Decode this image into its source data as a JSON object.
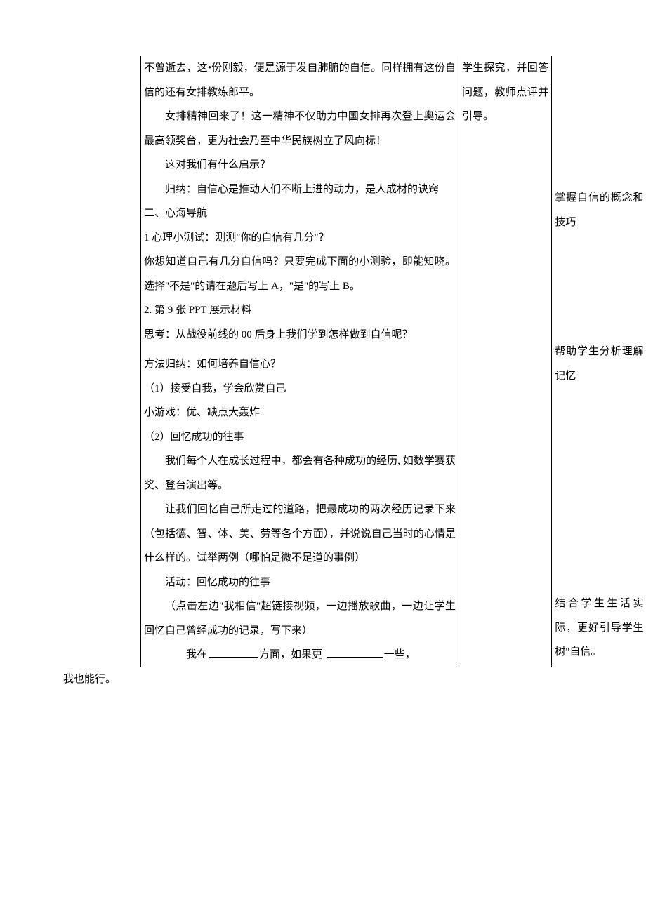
{
  "col1": {
    "p1": "不曾逝去，这•份刚毅，便是源于发自肺腑的自信。同样拥有这份自信的还有女排教练郎平。",
    "p2": "女排精神回来了！这一精神不仅助力中国女排再次登上奥运会最高领奖台，更为社会乃至中华民族树立了风向标！",
    "p3": "这对我们有什么启示？",
    "p4": "归纳：自信心是推动人们不断上进的动力，是人成材的诀窍",
    "h1": "二、心海导航",
    "p5": "1 心理小测试：测测\"你的自信有几分\"？",
    "p6": "你想知道自己有几分自信吗？只要完成下面的小测验，即能知晓。选择\"不是\"的请在题后写上 A，\"是\"的写上 B。",
    "p7": "2. 第 9 张 PPT 展示材料",
    "p8": "思考：从战役前线的 00 后身上我们学到怎样做到自信呢？",
    "method_title": "方法归纳：如何培养自信心？",
    "m1": "（1）接受自我，学会欣赏自己",
    "m1b": "小游戏：优、缺点大轰炸",
    "m2": "（2）回忆成功的往事",
    "p9": "我们每个人在成长过程中，都会有各种成功的经历, 如数学赛获奖、登台演出等。",
    "p10": "让我们回忆自己所走过的道路，把最成功的两次经历记录下来（包括德、智、体、美、劳等各个方面），并说说自己当时的心情是什么样的。试举两例（哪怕是微不足道的事例）",
    "p11": "活动：回忆成功的往事",
    "p12": "（点击左边\"我相信\"超链接视频，一边播放歌曲，一边让学生回忆自己曾经成功的记录，写下来）",
    "fill_prefix": "我在",
    "fill_mid": "方面，如果更",
    "fill_suffix": "一些，"
  },
  "col2": {
    "p1": "学生探究，并回答问题，教师点评并引导。"
  },
  "col3": {
    "p1": "掌握自信的概念和技巧",
    "p2": "帮助学生分析理解记忆",
    "p3": "结合学生生活实际，更好引导学生树\"自信。"
  },
  "footer": "我也能行。"
}
